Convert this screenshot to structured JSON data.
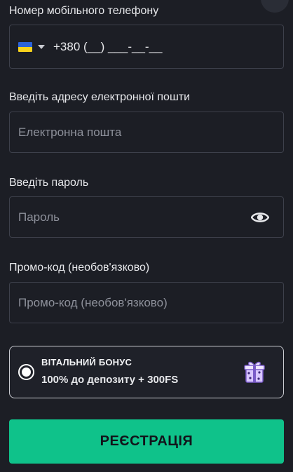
{
  "phone": {
    "label": "Номер мобільного телефону",
    "country_flag_icon": "ukraine-flag-icon",
    "value": "+380 (__) ___-__-__",
    "colors": {
      "flag_blue": "#2b63d9",
      "flag_yellow": "#f7d21c"
    }
  },
  "email": {
    "label": "Введіть адресу електронної пошти",
    "placeholder": "Електронна пошта"
  },
  "password": {
    "label": "Введіть пароль",
    "placeholder": "Пароль",
    "toggle_icon": "eye-icon"
  },
  "promo": {
    "label": "Промо-код (необов'язково)",
    "placeholder": "Промо-код (необов'язково)"
  },
  "bonus": {
    "title": "ВІТАЛЬНИЙ БОНУС",
    "description": "100% до депозиту + 300FS",
    "selected": true,
    "icon": "gift-icon"
  },
  "register": {
    "label": "РЕЄСТРАЦІЯ",
    "color": "#0fc28a"
  }
}
